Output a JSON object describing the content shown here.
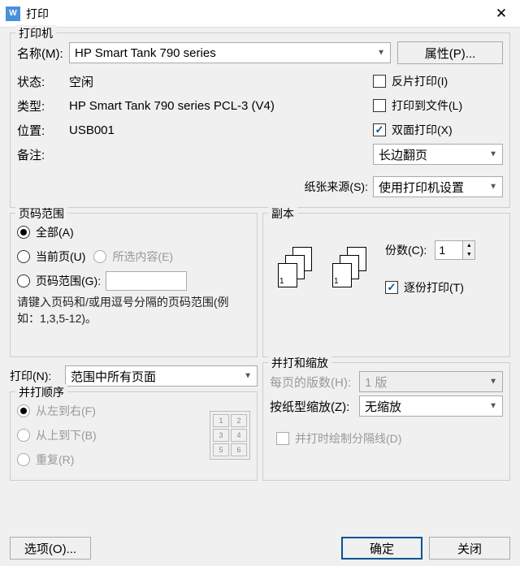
{
  "window": {
    "title": "打印",
    "app_glyph": "W"
  },
  "printer_group": {
    "title": "打印机",
    "name_label": "名称(M):",
    "name_value": "HP Smart Tank 790 series",
    "properties_btn": "属性(P)...",
    "status_label": "状态:",
    "status_value": "空闲",
    "type_label": "类型:",
    "type_value": "HP Smart Tank 790 series PCL-3 (V4)",
    "where_label": "位置:",
    "where_value": "USB001",
    "comment_label": "备注:",
    "inverse_label": "反片打印(I)",
    "print_to_file_label": "打印到文件(L)",
    "duplex_label": "双面打印(X)",
    "flip_value": "长边翻页",
    "paper_source_label": "纸张来源(S):",
    "paper_source_value": "使用打印机设置"
  },
  "range_group": {
    "title": "页码范围",
    "all_label": "全部(A)",
    "current_label": "当前页(U)",
    "selection_label": "所选内容(E)",
    "pages_label": "页码范围(G):",
    "hint": "请键入页码和/或用逗号分隔的页码范围(例如：1,3,5-12)。"
  },
  "copies_group": {
    "title": "副本",
    "copies_label": "份数(C):",
    "copies_value": "1",
    "collate_label": "逐份打印(T)"
  },
  "print_what_label": "打印(N):",
  "print_what_value": "范围中所有页面",
  "collate_order_group": {
    "title": "并打顺序",
    "ltr_label": "从左到右(F)",
    "ttb_label": "从上到下(B)",
    "repeat_label": "重复(R)"
  },
  "scaling_group": {
    "title": "并打和缩放",
    "pages_per_sheet_label": "每页的版数(H):",
    "pages_per_sheet_value": "1 版",
    "scale_label": "按纸型缩放(Z):",
    "scale_value": "无缩放",
    "draw_line_label": "并打时绘制分隔线(D)"
  },
  "footer": {
    "options_btn": "选项(O)...",
    "ok_btn": "确定",
    "close_btn": "关闭"
  }
}
